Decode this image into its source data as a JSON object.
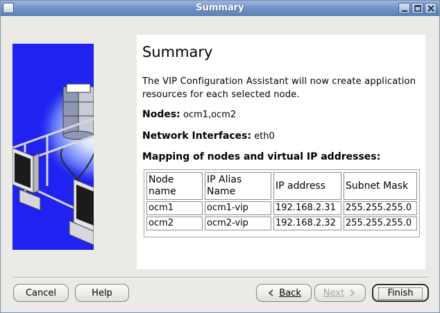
{
  "window": {
    "title": "Summary",
    "controls": [
      "minimize-icon",
      "maximize-icon",
      "close-icon"
    ]
  },
  "content": {
    "heading": "Summary",
    "description": "The VIP Configuration Assistant will now create application resources for each selected node.",
    "nodes_label": "Nodes:",
    "nodes_value": "ocm1,ocm2",
    "interfaces_label": "Network Interfaces:",
    "interfaces_value": "eth0",
    "mapping_label": "Mapping of nodes and virtual IP addresses:",
    "table": {
      "headers": [
        "Node name",
        "IP Alias Name",
        "IP address",
        "Subnet Mask"
      ],
      "rows": [
        [
          "ocm1",
          "ocm1-vip",
          "192.168.2.31",
          "255.255.255.0"
        ],
        [
          "ocm2",
          "ocm2-vip",
          "192.168.2.32",
          "255.255.255.0"
        ]
      ]
    }
  },
  "buttons": {
    "cancel": "Cancel",
    "help": "Help",
    "back": "Back",
    "next": "Next",
    "finish": "Finish"
  },
  "colors": {
    "titlebar": "#6d91c6",
    "art_background": "#1f22f0",
    "disabled_text": "#a9a9a9"
  }
}
